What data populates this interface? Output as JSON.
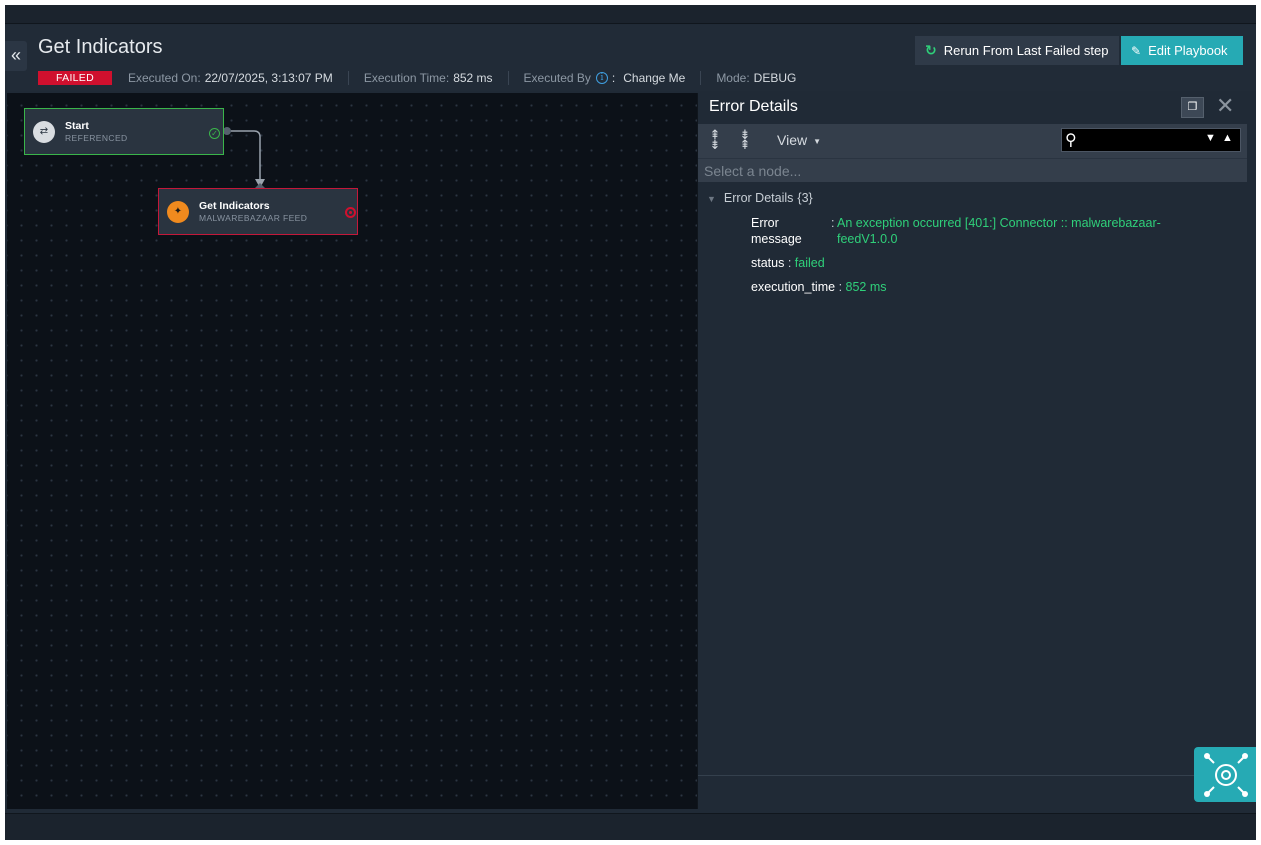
{
  "header": {
    "title": "Get Indicators",
    "status_badge": "FAILED",
    "executed_on_label": "Executed On:",
    "executed_on_value": "22/07/2025, 3:13:07 PM",
    "execution_time_label": "Execution Time:",
    "execution_time_value": "852 ms",
    "executed_by_label": "Executed By",
    "executed_by_value": "Change Me",
    "mode_label": "Mode:",
    "mode_value": "DEBUG",
    "rerun_label": "Rerun From Last Failed step",
    "edit_label": "Edit Playbook"
  },
  "canvas": {
    "nodes": [
      {
        "title": "Start",
        "subtitle": "REFERENCED",
        "status": "success"
      },
      {
        "title": "Get Indicators",
        "subtitle": "MALWAREBAZAAR FEED",
        "status": "failed"
      }
    ]
  },
  "panel": {
    "title": "Error Details",
    "view_label": "View",
    "select_placeholder": "Select a node...",
    "tree": {
      "root_label": "Error Details",
      "root_count": "{3}",
      "rows": [
        {
          "key": "Error message",
          "value": "An exception occurred [401:]  Connector :: malwarebazaar-feedV1.0.0"
        },
        {
          "key": "status",
          "value": "failed"
        },
        {
          "key": "execution_time",
          "value": "852 ms"
        }
      ]
    }
  },
  "colors": {
    "accent": "#26aab4",
    "failed": "#d0102e",
    "success": "#3ab54a",
    "value_green": "#2fd07a"
  },
  "icons": [
    "collapse-icon",
    "info-icon",
    "refresh-icon",
    "pencil-icon",
    "start-node-icon",
    "connector-node-icon",
    "copy-icon",
    "close-icon",
    "expand-all-icon",
    "collapse-all-icon",
    "search-icon",
    "next-match-icon",
    "prev-match-icon",
    "settings-network-icon"
  ]
}
